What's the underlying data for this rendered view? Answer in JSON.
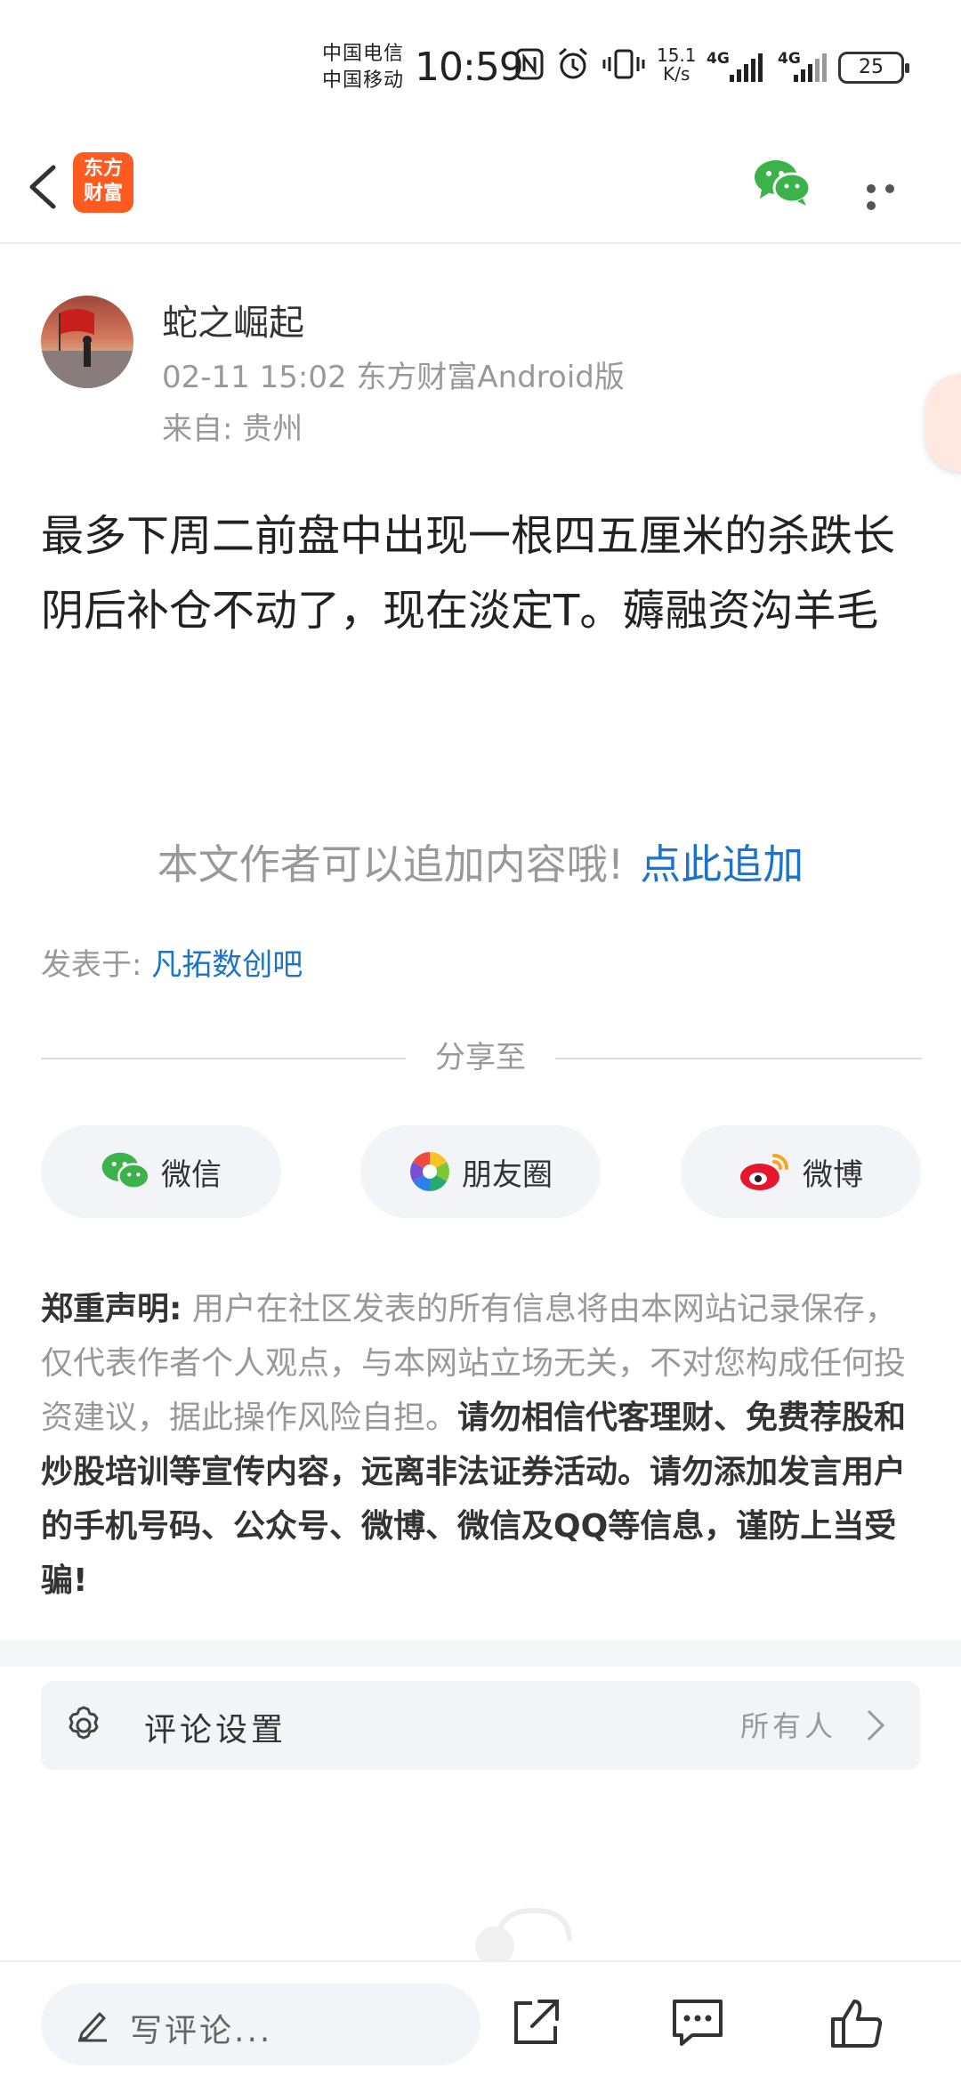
{
  "status_bar": {
    "carrier_1": "中国电信",
    "carrier_2": "中国移动",
    "time": "10:59",
    "speed_value": "15.1",
    "speed_unit": "K/s",
    "network_1": "4G",
    "network_2": "4G",
    "battery": "25"
  },
  "nav": {
    "logo_line1": "东方",
    "logo_line2": "财富",
    "brand_color": "#ff5a1f"
  },
  "author": {
    "name": "蛇之崛起",
    "meta": "02-11 15:02 东方财富Android版",
    "location": "来自: 贵州"
  },
  "post": {
    "content": "最多下周二前盘中出现一根四五厘米的杀跌长阴后补仓不动了，现在淡定T。薅融资沟羊毛"
  },
  "add_content": {
    "prompt": "本文作者可以追加内容哦!",
    "link": "点此追加"
  },
  "posted_in": {
    "label": "发表于:",
    "bar": "凡拓数创吧"
  },
  "share": {
    "title": "分享至",
    "wechat": "微信",
    "moments": "朋友圈",
    "weibo": "微博"
  },
  "disclaimer": {
    "label": "郑重声明",
    "colon": ":",
    "normal": "用户在社区发表的所有信息将由本网站记录保存，仅代表作者个人观点，与本网站立场无关，不对您构成任何投资建议，据此操作风险自担。",
    "bold": "请勿相信代客理财、免费荐股和炒股培训等宣传内容，远离非法证券活动。请勿添加发言用户的手机号码、公众号、微博、微信及QQ等信息，谨防上当受骗!"
  },
  "comment_settings": {
    "label": "评论设置",
    "value": "所有人"
  },
  "bottom_bar": {
    "comment_placeholder": "写评论..."
  },
  "colors": {
    "link": "#1c73c9",
    "wechat_green": "#3bb34a",
    "weibo_red": "#e6162d"
  }
}
